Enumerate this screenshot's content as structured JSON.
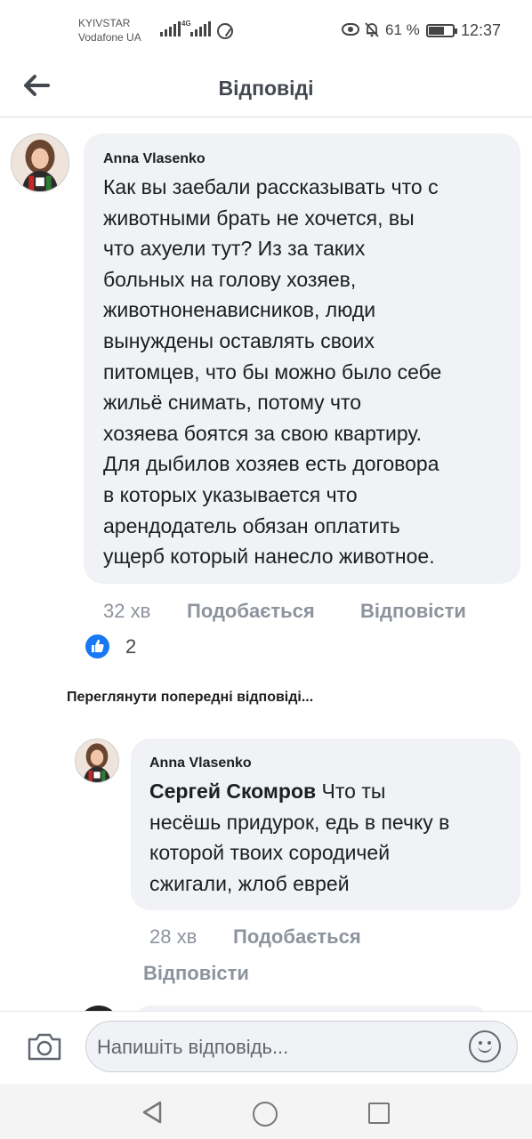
{
  "status_bar": {
    "carrier_1": "KYIVSTAR",
    "carrier_2": "Vodafone UA",
    "network": "4G",
    "battery": "61 %",
    "time": "12:37"
  },
  "header": {
    "title": "Відповіді"
  },
  "main_comment": {
    "author": "Anna Vlasenko",
    "text": "Как вы заебали рассказывать что с\nживотными брать не хочется, вы\nчто ахуели тут? Из за таких\nбольных на голову хозяев,\nживотноненависников, люди\nвынуждены оставлять своих\nпитомцев, что бы можно было себе\nжильё снимать, потому что\nхозяева боятся за свою квартиру.\nДля дыбилов хозяев есть договора\nв которых указывается что\nарендодатель обязан оплатить\nущерб который нанесло животное.",
    "time": "32 хв",
    "like_label": "Подобається",
    "reply_label": "Відповісти",
    "reaction_count": "2"
  },
  "view_previous": "Переглянути попередні відповіді...",
  "reply": {
    "author": "Anna Vlasenko",
    "mention": "Сергей Скомров",
    "text_line1": " Что ты",
    "text_rest": "несёшь придурок, едь в печку в\nкоторой твоих сородичей\nсжигали, жлоб еврей",
    "time": "28 хв",
    "like_label": "Подобається",
    "reply_label": "Відповісти"
  },
  "composer": {
    "placeholder": "Напишіть відповідь..."
  },
  "colors": {
    "bubble": "#f0f2f5",
    "meta_text": "#8d949e",
    "like_blue": "#1877f2"
  },
  "icons": {
    "back": "arrow-left-icon",
    "camera": "camera-icon",
    "emoji": "smiley-icon",
    "like": "thumbs-up-icon"
  }
}
